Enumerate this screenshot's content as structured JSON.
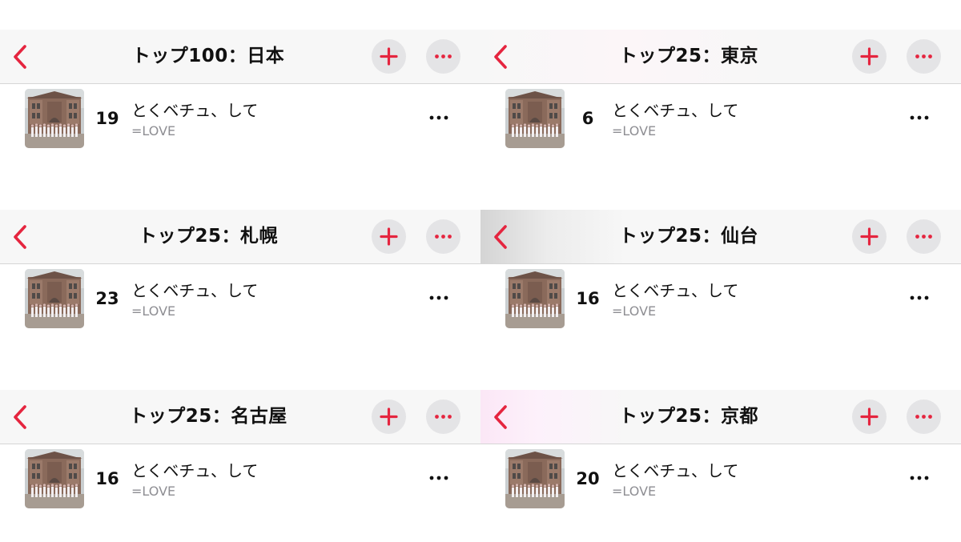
{
  "colors": {
    "accent": "#e5253f",
    "button_bg": "#e4e4e6",
    "secondary_text": "#8e8e93"
  },
  "icons": {
    "back": "chevron-left-icon",
    "add": "plus-icon",
    "more": "ellipsis-icon",
    "row_more": "ellipsis-icon"
  },
  "panels": [
    {
      "title": "トップ100：日本",
      "song": {
        "rank": "19",
        "title": "とくベチュ、して",
        "artist": "=LOVE"
      }
    },
    {
      "title": "トップ25：東京",
      "song": {
        "rank": "6",
        "title": "とくベチュ、して",
        "artist": "=LOVE"
      }
    },
    {
      "title": "トップ25：札幌",
      "song": {
        "rank": "23",
        "title": "とくベチュ、して",
        "artist": "=LOVE"
      }
    },
    {
      "title": "トップ25：仙台",
      "song": {
        "rank": "16",
        "title": "とくベチュ、して",
        "artist": "=LOVE"
      }
    },
    {
      "title": "トップ25：名古屋",
      "song": {
        "rank": "16",
        "title": "とくベチュ、して",
        "artist": "=LOVE"
      }
    },
    {
      "title": "トップ25：京都",
      "song": {
        "rank": "20",
        "title": "とくベチュ、して",
        "artist": "=LOVE"
      }
    }
  ]
}
